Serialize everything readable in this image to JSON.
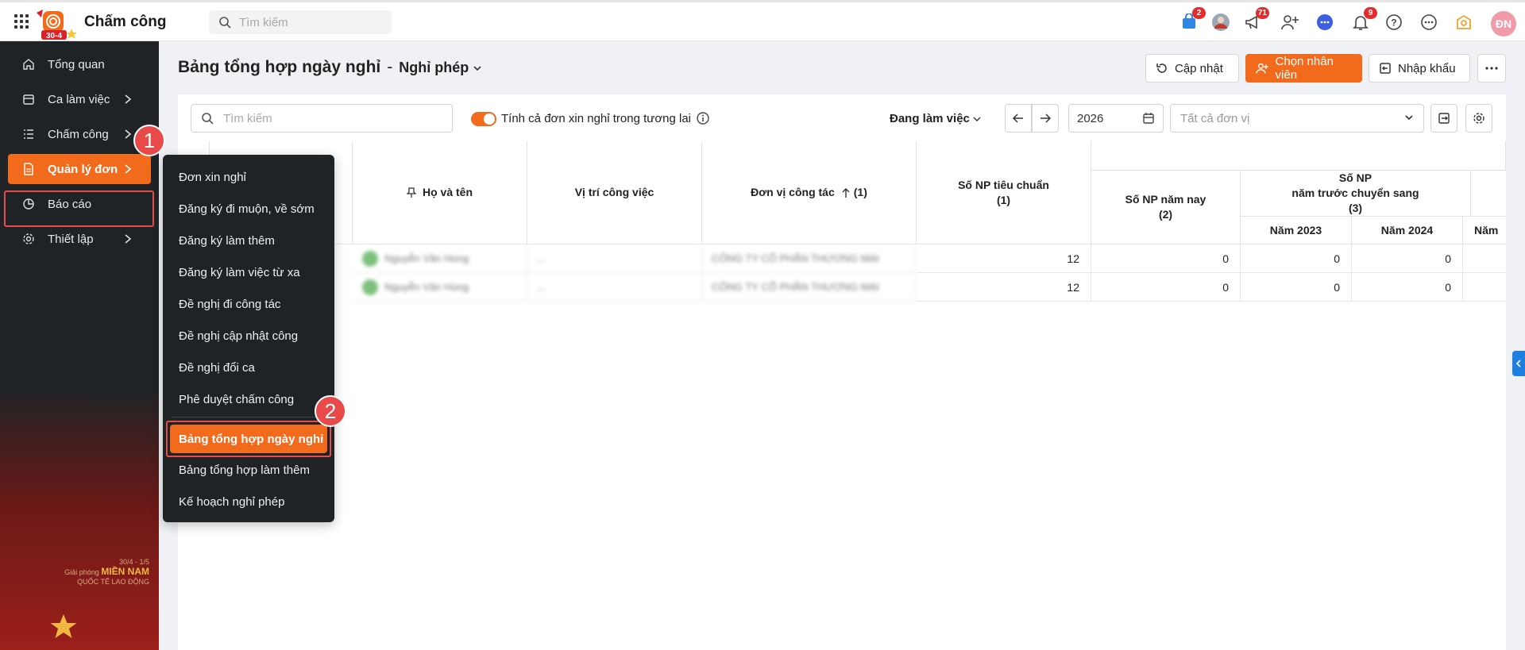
{
  "app": {
    "title": "Chấm công",
    "logo_text": "30-4"
  },
  "topbar": {
    "search_placeholder": "Tìm kiếm",
    "badges": {
      "cart": "2",
      "megaphone": "71",
      "bell": "9"
    },
    "avatar_initials": "ĐN"
  },
  "sidebar": {
    "items": [
      {
        "label": "Tổng quan",
        "icon": "home-icon"
      },
      {
        "label": "Ca làm việc",
        "icon": "calendar-icon"
      },
      {
        "label": "Chấm công",
        "icon": "checklist-icon"
      },
      {
        "label": "Quản lý đơn",
        "icon": "document-icon"
      },
      {
        "label": "Báo cáo",
        "icon": "pie-chart-icon"
      },
      {
        "label": "Thiết lập",
        "icon": "gear-icon"
      }
    ],
    "step1": "1",
    "promo": {
      "line1": "30/4 - 1/5",
      "line2a": "Giải phóng ",
      "line2b": "MIỀN NAM",
      "line3": "QUỐC TẾ LAO ĐỘNG"
    }
  },
  "header": {
    "title": "Bảng tổng hợp ngày nghỉ",
    "separator": "-",
    "subtitle": "Nghỉ phép",
    "buttons": {
      "refresh": "Cập nhật",
      "choose_employee": "Chọn nhân viên",
      "import": "Nhập khẩu"
    }
  },
  "toolbar": {
    "search_placeholder": "Tìm kiếm",
    "toggle_label": "Tính cả đơn xin nghỉ trong tương lai",
    "status_filter": "Đang làm việc",
    "year": "2026",
    "unit_placeholder": "Tất cả đơn vị"
  },
  "table": {
    "headers": {
      "name": "Họ và tên",
      "position": "Vị trí công việc",
      "unit": "Đơn vị công tác",
      "unit_sort": "(1)",
      "std_np": "Số NP tiêu chuẩn",
      "std_np_sub": "(1)",
      "this_year": "Số NP năm nay",
      "this_year_sub": "(2)",
      "prev_year": "Số NP",
      "prev_year_line2": "năm trước chuyển sang",
      "prev_year_sub": "(3)",
      "y2023": "Năm 2023",
      "y2024": "Năm 2024",
      "y2025": "Năm"
    },
    "rows": [
      {
        "name": "Nguyễn Văn Hùng",
        "position": "...",
        "unit": "CÔNG TY CỔ PHẦN THƯƠNG MẠI",
        "std": "12",
        "this_year": "0",
        "y2023": "0",
        "y2024": "0"
      },
      {
        "name": "Nguyễn Văn Hùng",
        "position": "...",
        "unit": "CÔNG TY CỔ PHẦN THƯƠNG MẠI",
        "std": "12",
        "this_year": "0",
        "y2023": "0",
        "y2024": "0"
      }
    ]
  },
  "submenu": {
    "items": [
      "Đơn xin nghỉ",
      "Đăng ký đi muộn, về sớm",
      "Đăng ký làm thêm",
      "Đăng ký làm việc từ xa",
      "Đề nghị đi công tác",
      "Đề nghị cập nhật công",
      "Đề nghị đổi ca",
      "Phê duyệt chấm công"
    ],
    "active": "Bảng tổng hợp ngày nghỉ",
    "after": [
      "Bảng tổng hợp làm thêm",
      "Kế hoạch nghỉ phép"
    ],
    "step2": "2"
  },
  "colors": {
    "accent": "#f26b1d",
    "sidebar_bg": "#1f2326",
    "highlight_frame": "#e74c4c"
  }
}
